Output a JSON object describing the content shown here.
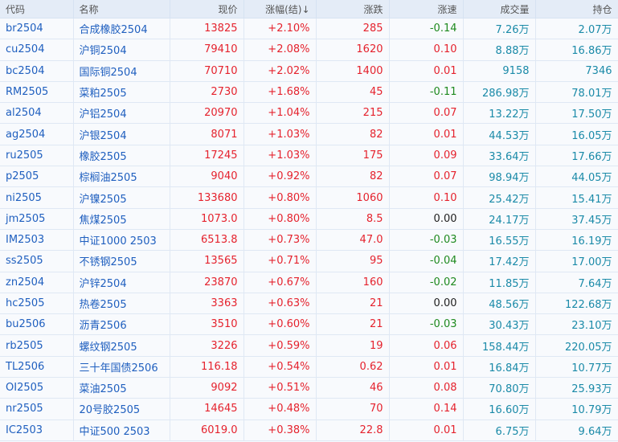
{
  "headers": [
    "代码",
    "名称",
    "现价",
    "涨幅(结)↓",
    "涨跌",
    "涨速",
    "成交量",
    "持仓"
  ],
  "rows": [
    [
      "br2504",
      "合成橡胶2504",
      "13825",
      "+2.10%",
      "285",
      "-0.14",
      "7.26万",
      "2.07万"
    ],
    [
      "cu2504",
      "沪铜2504",
      "79410",
      "+2.08%",
      "1620",
      "0.10",
      "8.88万",
      "16.86万"
    ],
    [
      "bc2504",
      "国际铜2504",
      "70710",
      "+2.02%",
      "1400",
      "0.01",
      "9158",
      "7346"
    ],
    [
      "RM2505",
      "菜粕2505",
      "2730",
      "+1.68%",
      "45",
      "-0.11",
      "286.98万",
      "78.01万"
    ],
    [
      "al2504",
      "沪铝2504",
      "20970",
      "+1.04%",
      "215",
      "0.07",
      "13.22万",
      "17.50万"
    ],
    [
      "ag2504",
      "沪银2504",
      "8071",
      "+1.03%",
      "82",
      "0.01",
      "44.53万",
      "16.05万"
    ],
    [
      "ru2505",
      "橡胶2505",
      "17245",
      "+1.03%",
      "175",
      "0.09",
      "33.64万",
      "17.66万"
    ],
    [
      "p2505",
      "棕榈油2505",
      "9040",
      "+0.92%",
      "82",
      "0.07",
      "98.94万",
      "44.05万"
    ],
    [
      "ni2505",
      "沪镍2505",
      "133680",
      "+0.80%",
      "1060",
      "0.10",
      "25.42万",
      "15.41万"
    ],
    [
      "jm2505",
      "焦煤2505",
      "1073.0",
      "+0.80%",
      "8.5",
      "0.00",
      "24.17万",
      "37.45万"
    ],
    [
      "IM2503",
      "中证1000 2503",
      "6513.8",
      "+0.73%",
      "47.0",
      "-0.03",
      "16.55万",
      "16.19万"
    ],
    [
      "ss2505",
      "不锈钢2505",
      "13565",
      "+0.71%",
      "95",
      "-0.04",
      "17.42万",
      "17.00万"
    ],
    [
      "zn2504",
      "沪锌2504",
      "23870",
      "+0.67%",
      "160",
      "-0.02",
      "11.85万",
      "7.64万"
    ],
    [
      "hc2505",
      "热卷2505",
      "3363",
      "+0.63%",
      "21",
      "0.00",
      "48.56万",
      "122.68万"
    ],
    [
      "bu2506",
      "沥青2506",
      "3510",
      "+0.60%",
      "21",
      "-0.03",
      "30.43万",
      "23.10万"
    ],
    [
      "rb2505",
      "螺纹钢2505",
      "3226",
      "+0.59%",
      "19",
      "0.06",
      "158.44万",
      "220.05万"
    ],
    [
      "TL2506",
      "三十年国债2506",
      "116.18",
      "+0.54%",
      "0.62",
      "0.01",
      "16.84万",
      "10.77万"
    ],
    [
      "OI2505",
      "菜油2505",
      "9092",
      "+0.51%",
      "46",
      "0.08",
      "70.80万",
      "25.93万"
    ],
    [
      "nr2505",
      "20号胶2505",
      "14645",
      "+0.48%",
      "70",
      "0.14",
      "16.60万",
      "10.79万"
    ],
    [
      "IC2503",
      "中证500 2503",
      "6019.0",
      "+0.38%",
      "22.8",
      "0.01",
      "6.75万",
      "9.64万"
    ]
  ]
}
